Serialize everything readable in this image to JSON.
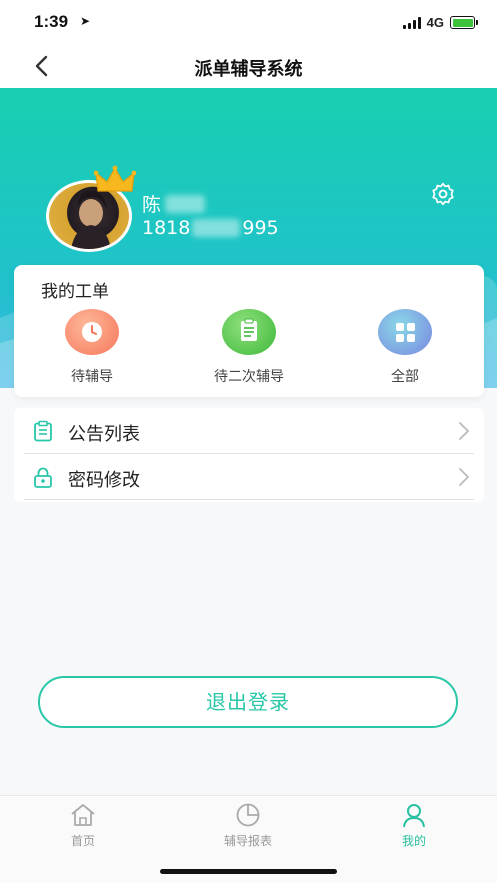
{
  "status_bar": {
    "time": "1:39",
    "network": "4G"
  },
  "header": {
    "title": "派单辅导系统",
    "back_icon": "chevron-left-icon"
  },
  "profile": {
    "name_visible": "陈",
    "phone_prefix": "1818",
    "phone_suffix": "995",
    "settings_icon": "gear-icon"
  },
  "orders": {
    "title": "我的工单",
    "items": [
      {
        "label": "待辅导",
        "icon": "clock-icon",
        "color": "#f77d5c"
      },
      {
        "label": "待二次辅导",
        "icon": "clipboard-icon",
        "color": "#45c242"
      },
      {
        "label": "全部",
        "icon": "grid-icon",
        "color": "#6d8fe6"
      }
    ]
  },
  "menu": [
    {
      "label": "公告列表",
      "icon": "clipboard-list-icon"
    },
    {
      "label": "密码修改",
      "icon": "lock-icon"
    }
  ],
  "logout_label": "退出登录",
  "tabs": [
    {
      "label": "首页",
      "icon": "home-icon",
      "active": false
    },
    {
      "label": "辅导报表",
      "icon": "pie-chart-icon",
      "active": false
    },
    {
      "label": "我的",
      "icon": "user-icon",
      "active": true
    }
  ],
  "colors": {
    "accent": "#28c7a8",
    "hero_top": "#19cfb1",
    "hero_bottom": "#36b6e6"
  }
}
